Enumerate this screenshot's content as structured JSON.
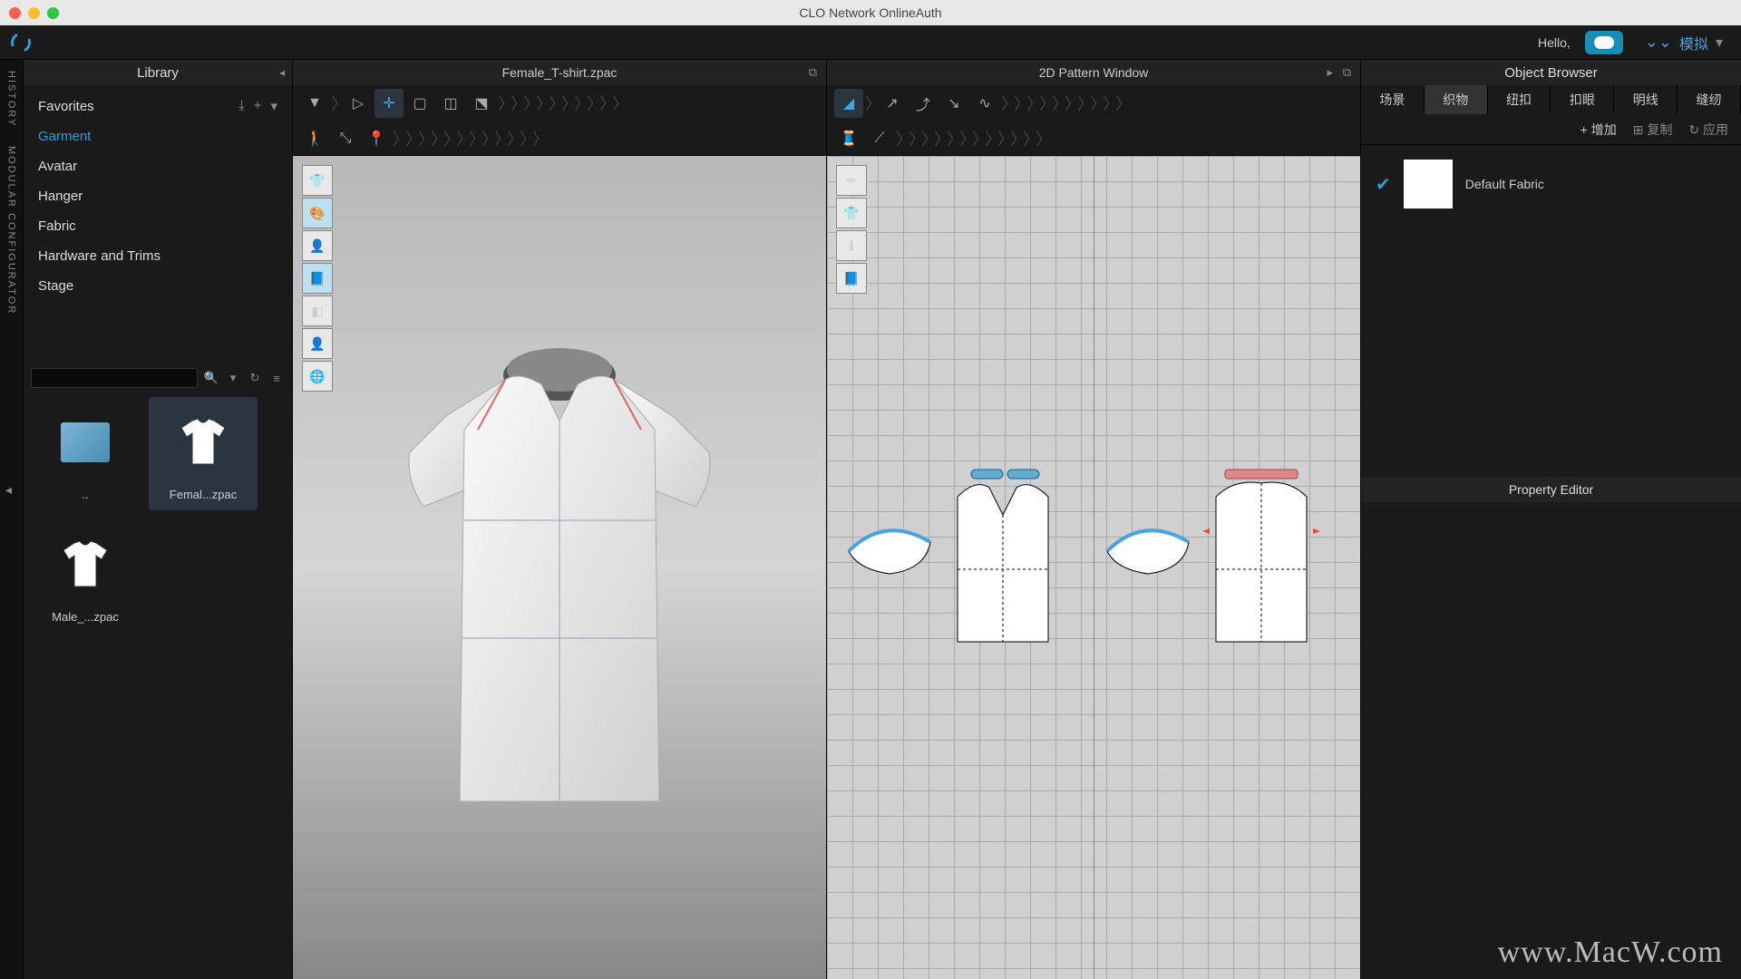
{
  "window": {
    "title": "CLO Network OnlineAuth"
  },
  "topbar": {
    "greeting": "Hello,",
    "simulate": "模拟"
  },
  "sidestrip": {
    "history": "HISTORY",
    "modular": "MODULAR CONFIGURATOR"
  },
  "library": {
    "title": "Library",
    "items": [
      "Favorites",
      "Garment",
      "Avatar",
      "Hanger",
      "Fabric",
      "Hardware and Trims",
      "Stage"
    ],
    "selected": "Garment",
    "thumbs": {
      "up": "..",
      "female": "Femal...zpac",
      "male": "Male_...zpac"
    }
  },
  "view3d": {
    "title": "Female_T-shirt.zpac"
  },
  "view2d": {
    "title": "2D Pattern Window"
  },
  "objectBrowser": {
    "title": "Object Browser",
    "tabs": [
      "场景",
      "织物",
      "纽扣",
      "扣眼",
      "明线",
      "缝纫"
    ],
    "activeTab": "织物",
    "actions": {
      "add": "增加",
      "copy": "复制",
      "apply": "应用"
    },
    "items": [
      {
        "name": "Default Fabric"
      }
    ]
  },
  "propertyEditor": {
    "title": "Property Editor"
  },
  "watermark": "www.MacW.com"
}
